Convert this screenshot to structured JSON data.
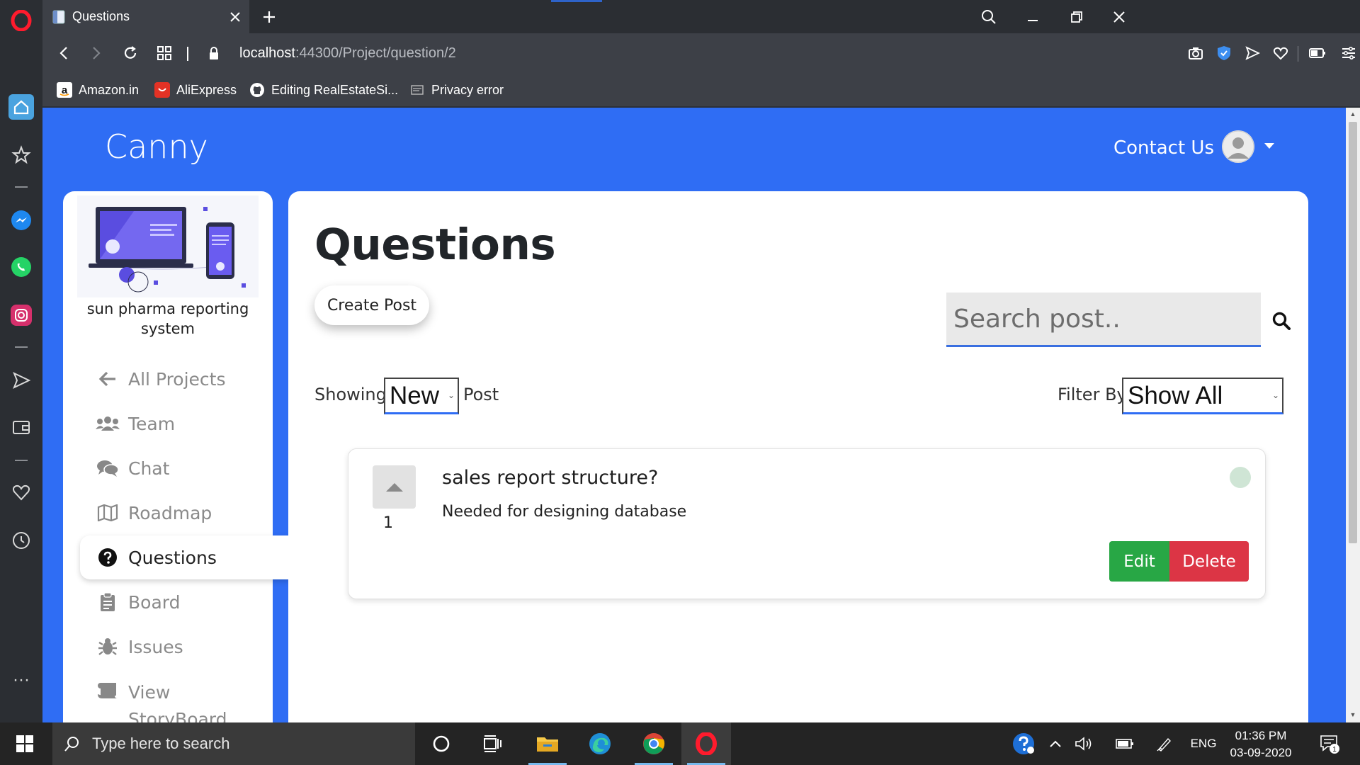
{
  "browser": {
    "tab": {
      "title": "Questions"
    },
    "address": {
      "host": "localhost",
      "rest": ":44300/Project/question/2"
    },
    "bookmarks": [
      {
        "label": "Amazon.in"
      },
      {
        "label": "AliExpress"
      },
      {
        "label": "Editing RealEstateSi..."
      },
      {
        "label": "Privacy error"
      }
    ]
  },
  "app": {
    "brand": "Canny",
    "contact": "Contact Us",
    "project_name": "sun pharma reporting system",
    "nav": [
      {
        "label": "All Projects",
        "icon": "arrow-left-icon"
      },
      {
        "label": "Team",
        "icon": "users-icon"
      },
      {
        "label": "Chat",
        "icon": "comments-icon"
      },
      {
        "label": "Roadmap",
        "icon": "map-icon"
      },
      {
        "label": "Questions",
        "icon": "question-circle-icon",
        "active": true
      },
      {
        "label": "Board",
        "icon": "clipboard-icon"
      },
      {
        "label": "Issues",
        "icon": "bug-icon"
      },
      {
        "label": "View StoryBoard",
        "icon": "scroll-icon"
      }
    ]
  },
  "page": {
    "title": "Questions",
    "create_label": "Create Post",
    "search_placeholder": "Search post..",
    "showing_label": "Showing",
    "sort_value": "New",
    "post_label": "Post",
    "filter_label": "Filter By",
    "filter_value": "Show All"
  },
  "post": {
    "votes": "1",
    "title": "sales report structure?",
    "description": "Needed for designing database",
    "edit_label": "Edit",
    "delete_label": "Delete"
  },
  "taskbar": {
    "search_placeholder": "Type here to search",
    "lang": "ENG",
    "time": "01:36 PM",
    "date": "03-09-2020",
    "notification_count": "1"
  },
  "colors": {
    "page_bg": "#2f6df4",
    "edit": "#28a745",
    "delete": "#dc3545"
  }
}
